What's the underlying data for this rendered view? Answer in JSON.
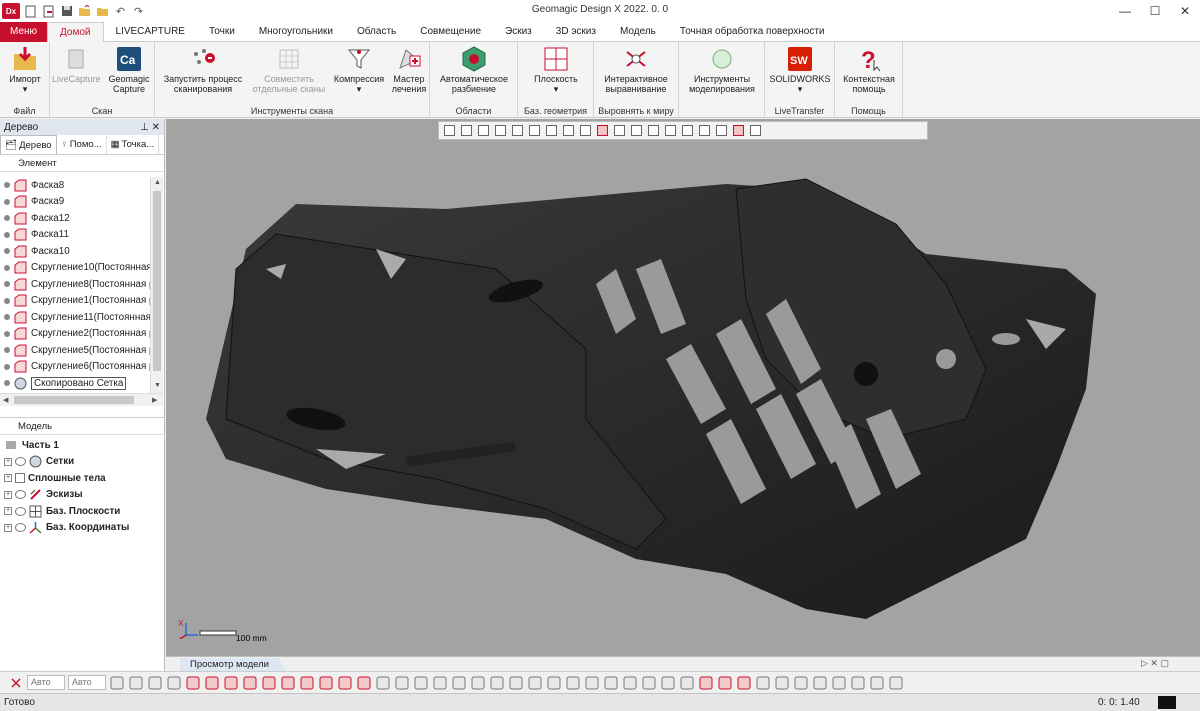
{
  "titlebar": {
    "app_logo": "Dx",
    "title": "Geomagic Design X 2022. 0. 0",
    "minimize": "—",
    "maximize": "☐",
    "close": "✕"
  },
  "tabs": [
    {
      "label": "Меню"
    },
    {
      "label": "Домой"
    },
    {
      "label": "LIVECAPTURE"
    },
    {
      "label": "Точки"
    },
    {
      "label": "Многоугольники"
    },
    {
      "label": "Область"
    },
    {
      "label": "Совмещение"
    },
    {
      "label": "Эскиз"
    },
    {
      "label": "3D эскиз"
    },
    {
      "label": "Модель"
    },
    {
      "label": "Точная обработка поверхности"
    }
  ],
  "ribbon": {
    "import_label": "Импорт",
    "group_file": "Файл",
    "livecapture_label": "LiveCapture",
    "geomagic_capture_line1": "Geomagic",
    "geomagic_capture_line2": "Capture",
    "group_scan": "Скан",
    "start_scan_line1": "Запустить процесс",
    "start_scan_line2": "сканирования",
    "combine_line1": "Совместить",
    "combine_line2": "отдельные сканы",
    "compress_label": "Компрессия",
    "healing_line1": "Мастер",
    "healing_line2": "лечения",
    "group_scan_tools": "Инструменты скана",
    "autosegment_line1": "Автоматическое",
    "autosegment_line2": "разбиение",
    "group_regions": "Области",
    "plane_label": "Плоскость",
    "group_ref_geom": "Баз. геометрия",
    "interactive_align_line1": "Интерактивное",
    "interactive_align_line2": "выравнивание",
    "group_align_world": "Выровнять к миру",
    "modeling_tools_line1": "Инструменты",
    "modeling_tools_line2": "моделирования",
    "solidworks_label": "SOLIDWORKS",
    "group_livetransfer": "LiveTransfer",
    "context_help_line1": "Контекстная",
    "context_help_line2": "помощь",
    "group_help": "Помощь",
    "colors": {
      "accent": "#c8102e"
    }
  },
  "leftpanel": {
    "header": "Дерево",
    "tabs": [
      {
        "label": "Дерево"
      },
      {
        "label": "Помо..."
      },
      {
        "label": "Точка..."
      }
    ],
    "element_header": "Элемент",
    "tree_items": [
      {
        "label": "Фаска8"
      },
      {
        "label": "Фаска9"
      },
      {
        "label": "Фаска12"
      },
      {
        "label": "Фаска11"
      },
      {
        "label": "Фаска10"
      },
      {
        "label": "Скругление10(Постоянная"
      },
      {
        "label": "Скругление8(Постоянная р"
      },
      {
        "label": "Скругление1(Постоянная р"
      },
      {
        "label": "Скругление11(Постоянная"
      },
      {
        "label": "Скругление2(Постоянная р"
      },
      {
        "label": "Скругление5(Постоянная р"
      },
      {
        "label": "Скругление6(Постоянная р"
      },
      {
        "label": "Скопировано Сетка"
      }
    ],
    "model_header": "Модель",
    "model_items": [
      {
        "label": "Часть 1"
      },
      {
        "label": "Сетки"
      },
      {
        "label": "Сплошные тела"
      },
      {
        "label": "Эскизы"
      },
      {
        "label": "Баз. Плоскости"
      },
      {
        "label": "Баз. Координаты"
      }
    ]
  },
  "viewport": {
    "scale_label": "100 mm",
    "axis_x": "X",
    "tab_label": "Просмотр модели",
    "background": "#a3a3a3"
  },
  "bottom_toolbar": {
    "combo1": "Авто",
    "combo2": "Авто"
  },
  "status": {
    "text": "Готово",
    "time": "0: 0: 1.40"
  }
}
